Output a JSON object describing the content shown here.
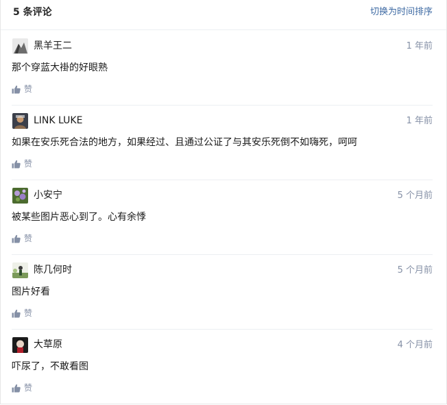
{
  "header": {
    "title": "5 条评论",
    "sort_label": "切换为时间排序"
  },
  "comments": [
    {
      "author": "黑羊王二",
      "time": "1 年前",
      "text": "那个穿蓝大褂的好眼熟",
      "like_label": "赞"
    },
    {
      "author": "LINK LUKE",
      "time": "1 年前",
      "text": "如果在安乐死合法的地方，如果经过、且通过公证了与其安乐死倒不如嗨死，呵呵",
      "like_label": "赞"
    },
    {
      "author": "小安宁",
      "time": "5 个月前",
      "text": "被某些图片恶心到了。心有余悸",
      "like_label": "赞"
    },
    {
      "author": "陈几何时",
      "time": "5 个月前",
      "text": "图片好看",
      "like_label": "赞"
    },
    {
      "author": "大草原",
      "time": "4 个月前",
      "text": "吓尿了，不敢看图",
      "like_label": "赞"
    }
  ],
  "icons": {
    "like": "thumbs-up-icon",
    "avatar": "user-avatar"
  },
  "colors": {
    "link": "#3e6aa3",
    "muted": "#8590a6",
    "text": "#1a1a1a",
    "divider": "#eceef2"
  }
}
